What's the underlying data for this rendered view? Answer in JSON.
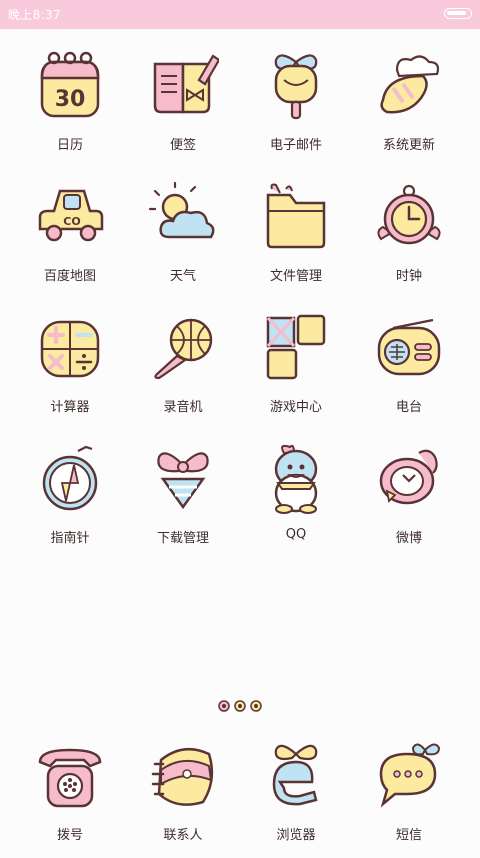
{
  "status_bar": {
    "time": "晚上8:37",
    "battery_level": 0.9
  },
  "apps": [
    {
      "label": "日历",
      "icon": "calendar-icon",
      "calendar_day": "30"
    },
    {
      "label": "便签",
      "icon": "notepad-icon"
    },
    {
      "label": "电子邮件",
      "icon": "email-icon"
    },
    {
      "label": "系统更新",
      "icon": "system-update-icon"
    },
    {
      "label": "百度地图",
      "icon": "car-map-icon",
      "car_text": "CO"
    },
    {
      "label": "天气",
      "icon": "weather-icon"
    },
    {
      "label": "文件管理",
      "icon": "folder-icon"
    },
    {
      "label": "时钟",
      "icon": "alarm-clock-icon"
    },
    {
      "label": "计算器",
      "icon": "calculator-icon"
    },
    {
      "label": "录音机",
      "icon": "microphone-icon"
    },
    {
      "label": "游戏中心",
      "icon": "game-blocks-icon"
    },
    {
      "label": "电台",
      "icon": "radio-icon"
    },
    {
      "label": "指南针",
      "icon": "compass-icon"
    },
    {
      "label": "下载管理",
      "icon": "download-bow-icon"
    },
    {
      "label": "QQ",
      "icon": "penguin-icon"
    },
    {
      "label": "微博",
      "icon": "weibo-icon"
    }
  ],
  "page_indicator": {
    "pages": 3,
    "current": 0
  },
  "dock": [
    {
      "label": "拨号",
      "icon": "telephone-icon"
    },
    {
      "label": "联系人",
      "icon": "contacts-book-icon"
    },
    {
      "label": "浏览器",
      "icon": "browser-e-icon"
    },
    {
      "label": "短信",
      "icon": "message-bubble-icon"
    }
  ],
  "colors": {
    "status_bar": "#f9cadb",
    "outline": "#5a3434",
    "yellow": "#fbeaa0",
    "pink": "#f6bccb",
    "blue": "#bfe3f2",
    "background": "#fdfcfd"
  }
}
